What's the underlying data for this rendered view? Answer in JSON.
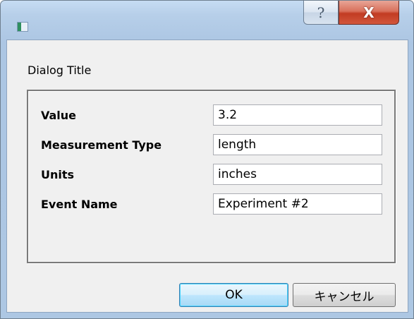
{
  "window": {
    "help_glyph": "?",
    "close_glyph": "X",
    "icon": "app-icon",
    "colors": {
      "titlebar": "#b7cfe9",
      "close_button": "#c23b22",
      "client_bg": "#f0f0f0"
    }
  },
  "dialog": {
    "title": "Dialog Title",
    "fields": [
      {
        "label": "Value",
        "value": "3.2"
      },
      {
        "label": "Measurement Type",
        "value": "length"
      },
      {
        "label": "Units",
        "value": "inches"
      },
      {
        "label": "Event Name",
        "value": "Experiment #2"
      }
    ],
    "buttons": {
      "ok_label": "OK",
      "cancel_label": "キャンセル"
    }
  }
}
